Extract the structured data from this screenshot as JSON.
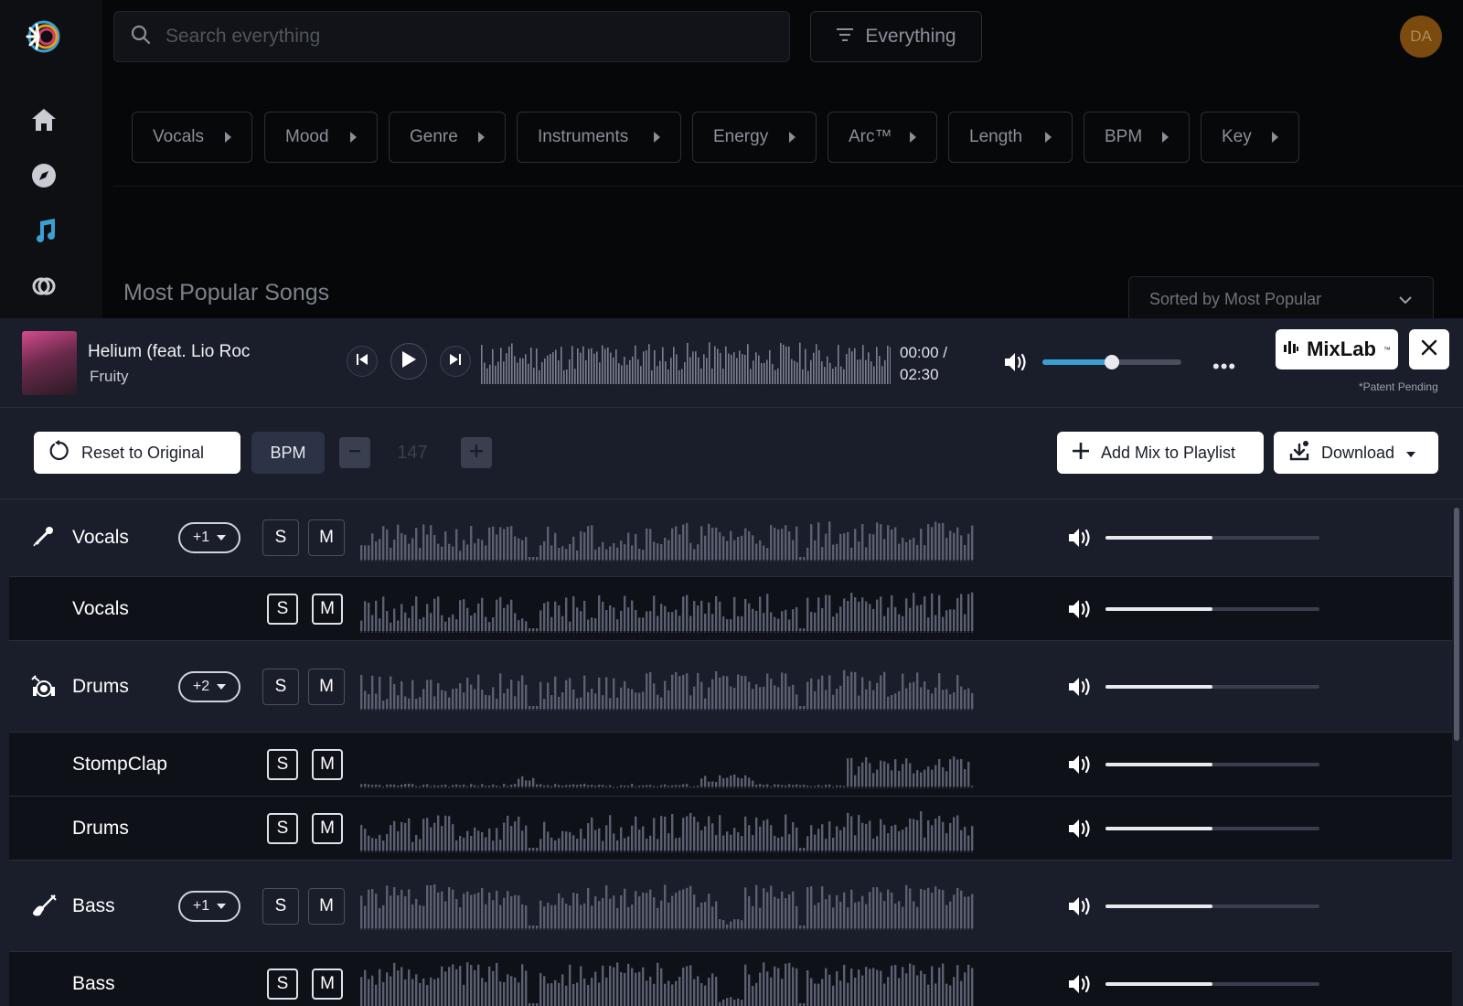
{
  "search": {
    "placeholder": "Search everything"
  },
  "filter": {
    "label": "Everything"
  },
  "avatar": {
    "initials": "DA"
  },
  "chips": [
    {
      "label": "Vocals"
    },
    {
      "label": "Mood"
    },
    {
      "label": "Genre"
    },
    {
      "label": "Instruments"
    },
    {
      "label": "Energy"
    },
    {
      "label": "Arc™"
    },
    {
      "label": "Length"
    },
    {
      "label": "BPM"
    },
    {
      "label": "Key"
    }
  ],
  "section": {
    "title": "Most Popular Songs",
    "sort_label": "Sorted by Most Popular"
  },
  "player": {
    "title": "Helium (feat. Lio Roc",
    "artist": "Fruity",
    "time_current": "00:00 /",
    "time_total": "02:30",
    "volume_level": 0.5,
    "mixlab_label": "MixLab",
    "mixlab_tm": "™",
    "patent": "*Patent Pending"
  },
  "toolbar": {
    "reset_label": "Reset to Original",
    "bpm_label": "BPM",
    "bpm_value": "147",
    "add_mix_label": "Add Mix to Playlist",
    "download_label": "Download"
  },
  "stems": [
    {
      "name": "Vocals",
      "kind": "group",
      "badge": "+1",
      "icon": "microphone-icon"
    },
    {
      "name": "Vocals",
      "kind": "sub"
    },
    {
      "name": "Drums",
      "kind": "group",
      "badge": "+2",
      "icon": "drum-kit-icon"
    },
    {
      "name": "StompClap",
      "kind": "sub"
    },
    {
      "name": "Drums",
      "kind": "sub"
    },
    {
      "name": "Bass",
      "kind": "group",
      "badge": "+1",
      "icon": "bass-guitar-icon"
    },
    {
      "name": "Bass",
      "kind": "sub"
    }
  ],
  "stem_controls": {
    "solo": "S",
    "mute": "M"
  },
  "stem_volume_level": 0.5,
  "colors": {
    "accent": "#3aa0d0",
    "player_bg": "#1a1d2a",
    "page_bg": "#060709"
  }
}
